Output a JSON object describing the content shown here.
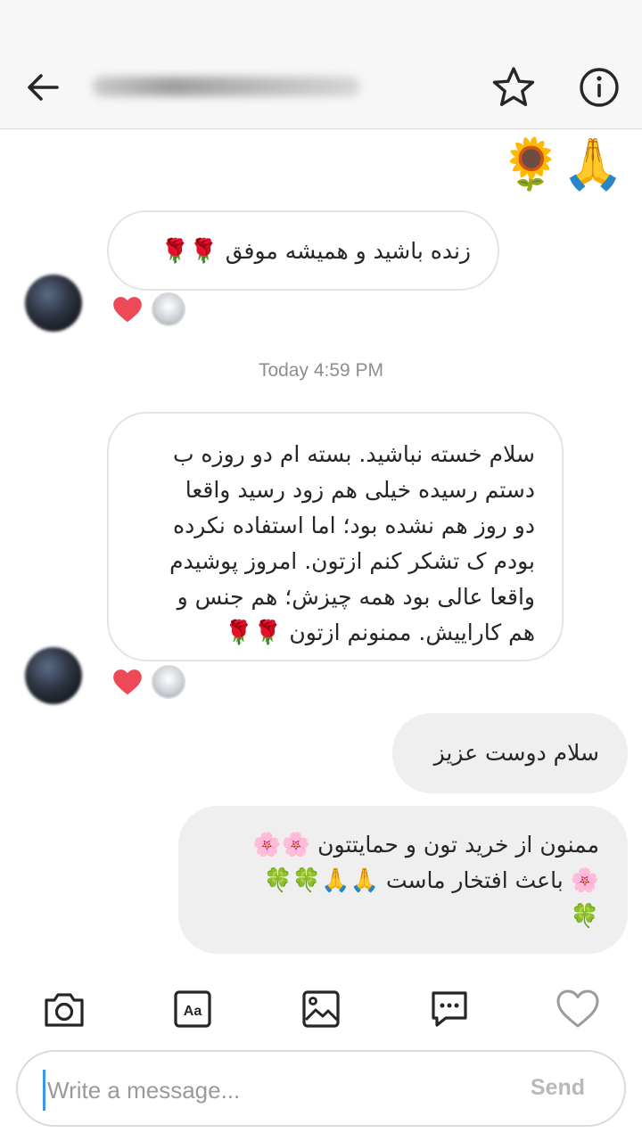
{
  "header": {
    "back_icon": "arrow-left-icon",
    "star_icon": "star-outline-icon",
    "info_icon": "info-circle-icon"
  },
  "messages": [
    {
      "side": "in",
      "text": "زنده باشید و همیشه موفق",
      "trailing_emoji": "🌹🌹"
    },
    {
      "side": "in",
      "lines": [
        "سلام خسته نباشید. بسته ام دو روزه ب",
        "دستم رسیده خیلی هم زود رسید واقعا",
        "دو روز هم نشده بود؛ اما استفاده نکرده",
        "بودم ک تشکر کنم ازتون. امروز پوشیدم",
        "واقعا عالی بود همه چیزش؛ هم جنس و",
        "هم کاراییش. ممنونم ازتون"
      ],
      "trailing_emoji": "🌹🌹"
    },
    {
      "side": "out",
      "text": "سلام دوست عزیز"
    },
    {
      "side": "out",
      "lines": [
        "ممنون از خرید تون و حمایتتون",
        "باعث افتخار ماست",
        ""
      ],
      "emoji_lines": [
        "🌸🌸",
        "🌸",
        "🙏🙏🍀🍀",
        "🍀"
      ]
    }
  ],
  "top_emojis": "🌻🙏",
  "timestamp": "Today 4:59 PM",
  "composer": {
    "placeholder": "Write a message...",
    "send_label": "Send"
  },
  "toolbar": [
    "camera-icon",
    "text-style-icon",
    "gallery-icon",
    "chat-bubble-icon",
    "heart-icon"
  ],
  "colors": {
    "accent": "#3897f0",
    "heart": "#ed4956",
    "bubble_out": "#efefef",
    "header_bg": "#f7f7f7"
  }
}
